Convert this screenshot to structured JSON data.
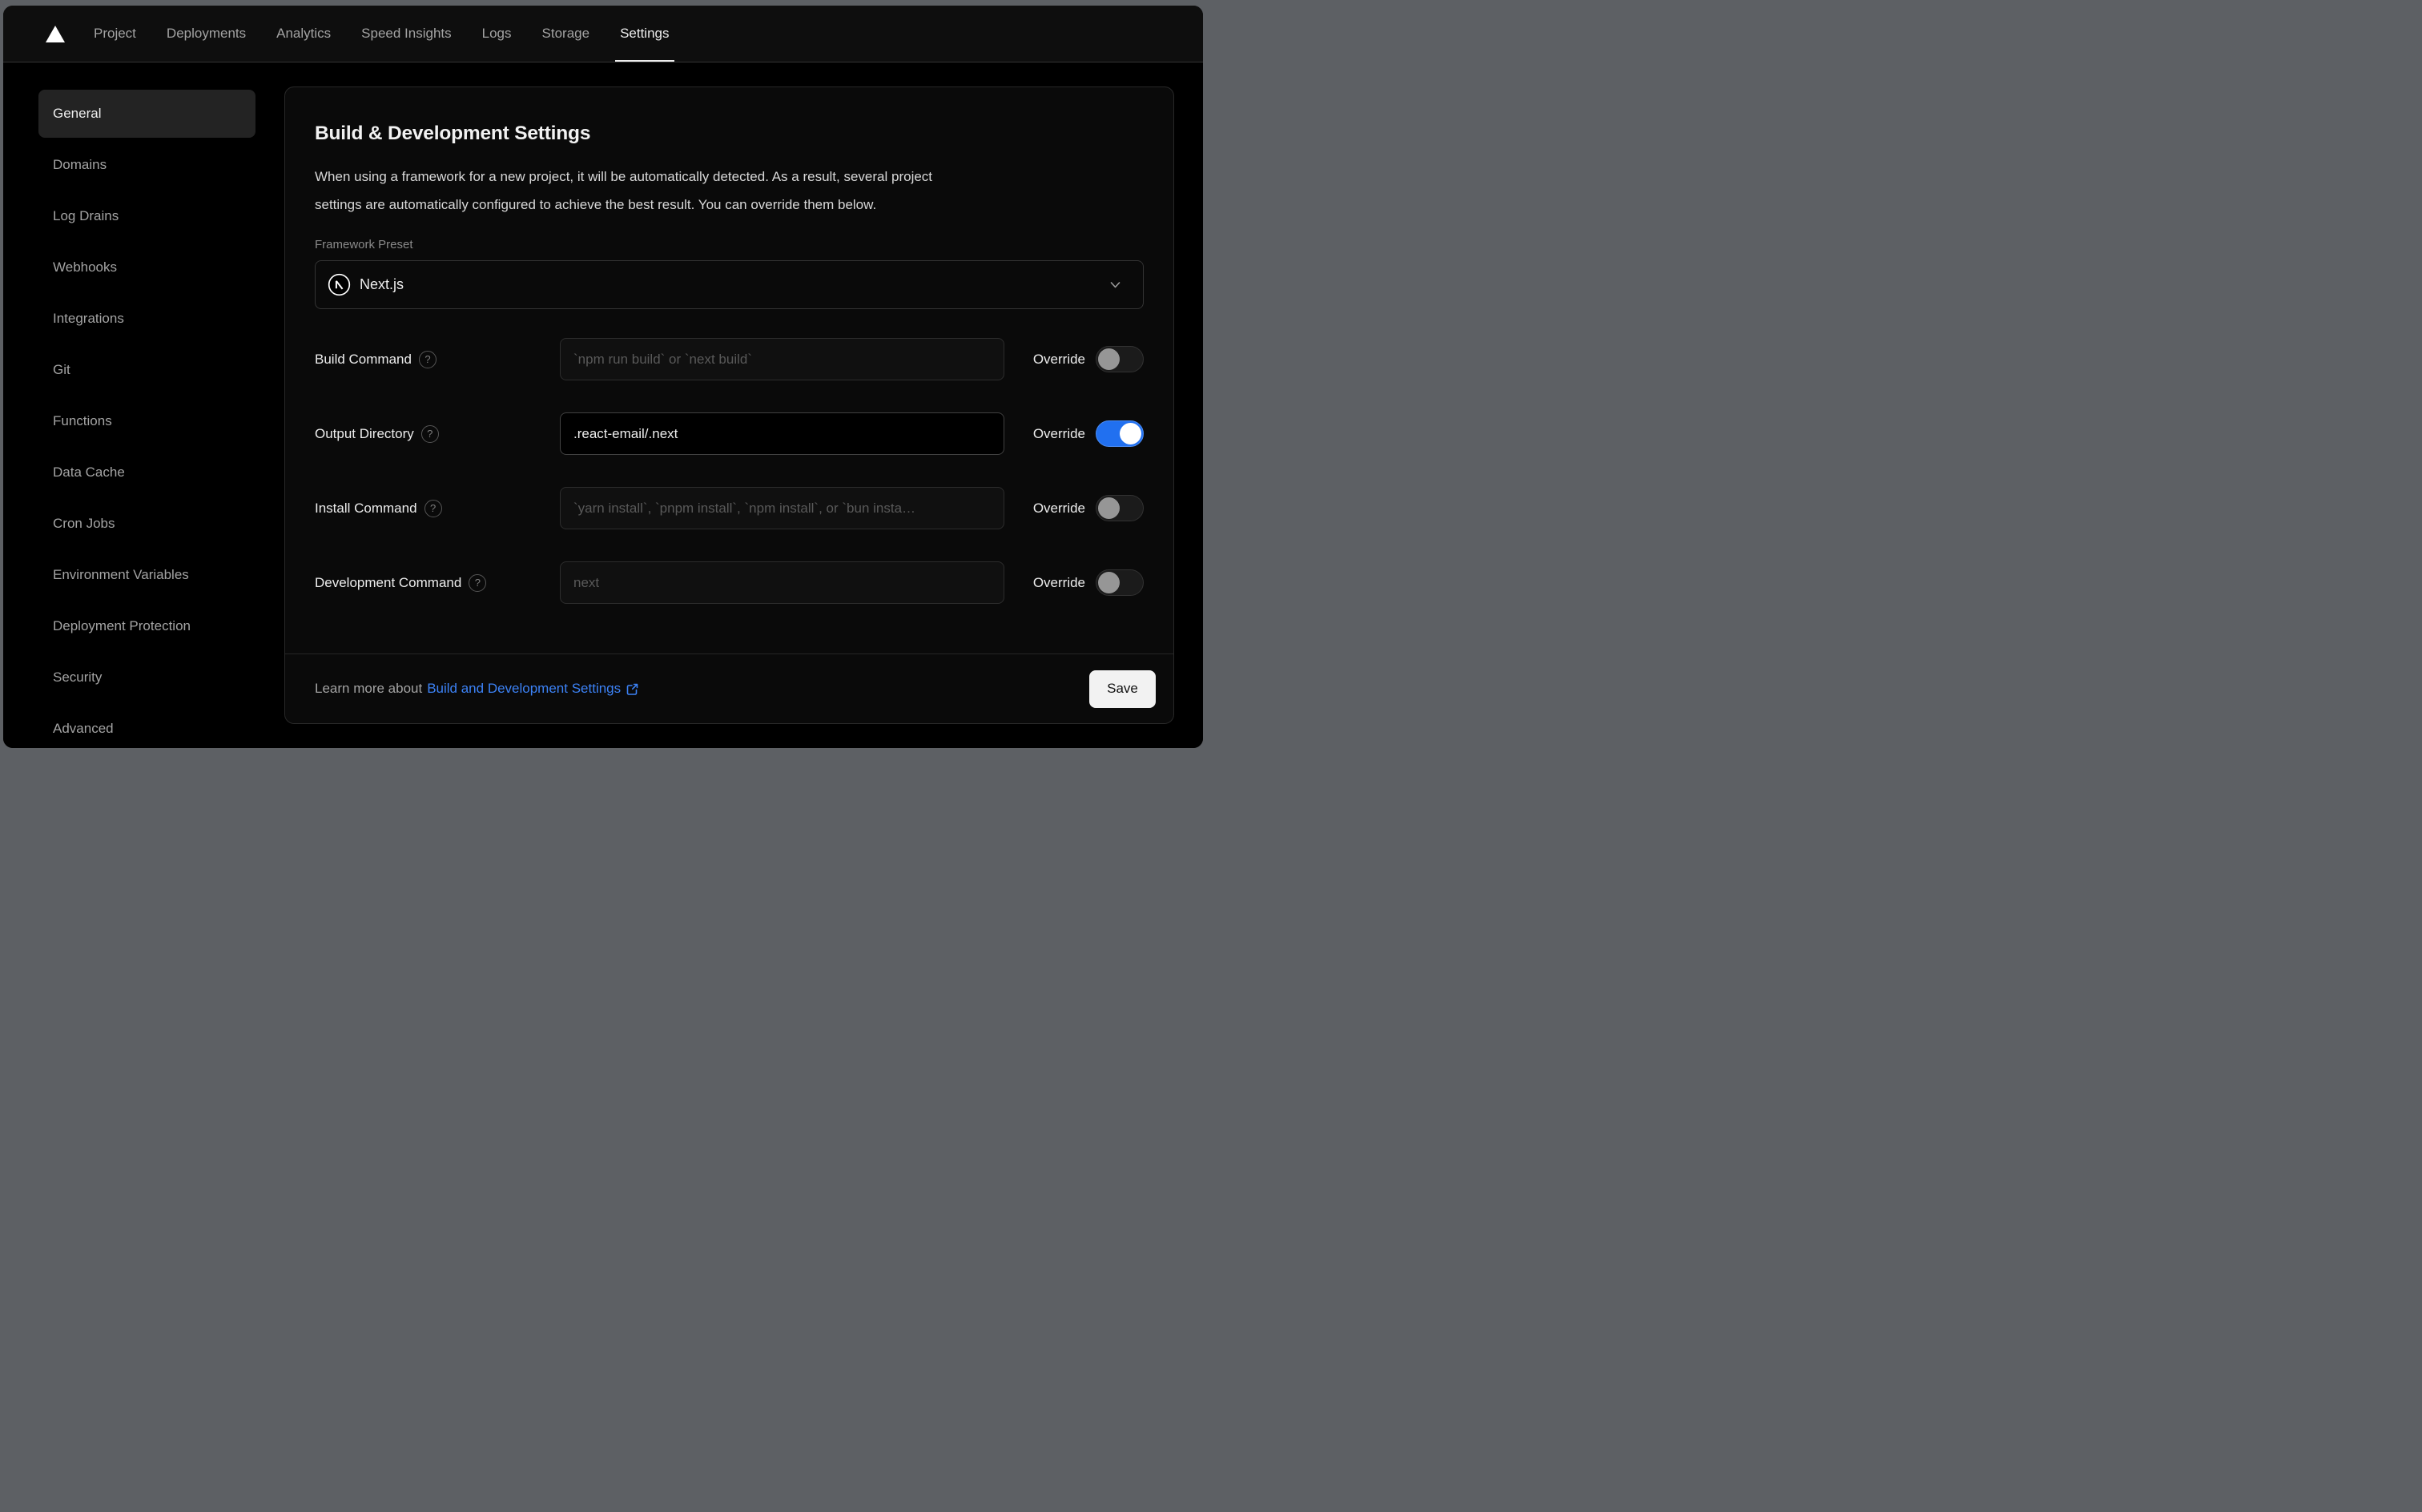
{
  "nav": {
    "items": [
      "Project",
      "Deployments",
      "Analytics",
      "Speed Insights",
      "Logs",
      "Storage",
      "Settings"
    ],
    "active": "Settings"
  },
  "sidebar": {
    "items": [
      "General",
      "Domains",
      "Log Drains",
      "Webhooks",
      "Integrations",
      "Git",
      "Functions",
      "Data Cache",
      "Cron Jobs",
      "Environment Variables",
      "Deployment Protection",
      "Security",
      "Advanced"
    ],
    "active": "General"
  },
  "panel": {
    "title": "Build & Development Settings",
    "description_lines": [
      "When using a framework for a new project, it will be automatically detected. As a result, several project",
      "settings are automatically configured to achieve the best result. You can override them below."
    ],
    "framework_preset": {
      "label": "Framework Preset",
      "value": "Next.js"
    },
    "override_label": "Override",
    "rows": [
      {
        "label": "Build Command",
        "placeholder": "`npm run build` or `next build`",
        "value": "",
        "override": false
      },
      {
        "label": "Output Directory",
        "placeholder": "",
        "value": ".react-email/.next",
        "override": true
      },
      {
        "label": "Install Command",
        "placeholder": "`yarn install`, `pnpm install`, `npm install`, or `bun insta…",
        "value": "",
        "override": false
      },
      {
        "label": "Development Command",
        "placeholder": "next",
        "value": "",
        "override": false
      }
    ],
    "footer": {
      "prefix": "Learn more about",
      "link_text": "Build and Development Settings",
      "save_label": "Save"
    }
  },
  "icons": {
    "help_glyph": "?"
  },
  "colors": {
    "toggle_on_blue": "#2170f0",
    "link_blue": "#3c82f6",
    "save_button_bg": "#f2f2f2",
    "card_bg": "#0a0a0a",
    "page_bg": "#000000",
    "backdrop_gray": "#5d6064",
    "active_sidebar_bg": "#232323"
  }
}
